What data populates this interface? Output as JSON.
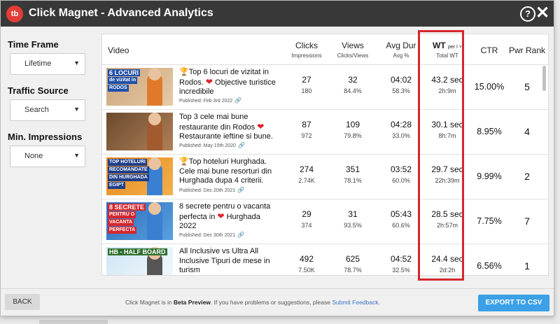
{
  "window": {
    "title": "Click Magnet - Advanced Analytics",
    "logo_text": "tb",
    "help_icon": "question-circle-icon",
    "close_icon": "close-icon"
  },
  "filters": {
    "time_frame": {
      "label": "Time Frame",
      "value": "Lifetime"
    },
    "traffic_source": {
      "label": "Traffic Source",
      "value": "Search"
    },
    "min_impressions": {
      "label": "Min. Impressions",
      "value": "None"
    }
  },
  "columns": {
    "video": "Video",
    "clicks": {
      "main": "Clicks",
      "sub": "Impressions"
    },
    "views": {
      "main": "Views",
      "sub": "Clicks/Views"
    },
    "avg_dur": {
      "main": "Avg Dur",
      "sub": "Avg %"
    },
    "wt": {
      "main": "WT",
      "per": "per I",
      "sub": "Total WT"
    },
    "ctr": "CTR",
    "pwr_rank": "Pwr Rank"
  },
  "rows": [
    {
      "title_pre": "Top 6 locuri de vizitat in Rodos.",
      "title_post": "Objective turistice incredibile",
      "trophy": true,
      "heart": true,
      "published": "Published: Feb 3rd 2022",
      "clicks": "27",
      "impressions": "180",
      "views": "32",
      "clicks_views": "84.4%",
      "avg_dur": "04:02",
      "avg_pct": "58.3%",
      "wt": "43.2 sec",
      "total_wt": "2h:9m",
      "ctr": "15.00%",
      "pwr_rank": "5",
      "thumb_text_1": "6 LOCURI",
      "thumb_text_2": "de vizitat in",
      "thumb_text_3": "RODOS"
    },
    {
      "title_pre": "Top 3 cele mai bune restaurante din Rodos",
      "title_post": "Restaurante ieftine si bune.",
      "trophy": false,
      "heart": true,
      "published": "Published: May 15th 2020",
      "clicks": "87",
      "impressions": "972",
      "views": "109",
      "clicks_views": "79.8%",
      "avg_dur": "04:28",
      "avg_pct": "33.0%",
      "wt": "30.1 sec",
      "total_wt": "8h:7m",
      "ctr": "8.95%",
      "pwr_rank": "4"
    },
    {
      "title_pre": "Top hoteluri Hurghada. Cele mai bune resorturi din Hurghada dupa 4 criterii.",
      "title_post": "",
      "trophy": true,
      "heart": false,
      "published": "Published: Dec 20th 2021",
      "clicks": "274",
      "impressions": "2.74K",
      "views": "351",
      "clicks_views": "78.1%",
      "avg_dur": "03:52",
      "avg_pct": "60.0%",
      "wt": "29.7 sec",
      "total_wt": "22h:39m",
      "ctr": "9.99%",
      "pwr_rank": "2",
      "thumb_text_1": "TOP HOTELURI",
      "thumb_text_2": "RECOMANDATE",
      "thumb_text_3": "DIN HURGHADA",
      "thumb_text_4": "EGIPT"
    },
    {
      "title_pre": "8 secrete pentru o vacanta perfecta in",
      "title_post": "Hurghada 2022",
      "trophy": false,
      "heart": true,
      "published": "Published: Dec 30th 2021",
      "clicks": "29",
      "impressions": "374",
      "views": "31",
      "clicks_views": "93.5%",
      "avg_dur": "05:43",
      "avg_pct": "60.6%",
      "wt": "28.5 sec",
      "total_wt": "2h:57m",
      "ctr": "7.75%",
      "pwr_rank": "7",
      "thumb_text_1": "8 SECRETE",
      "thumb_text_2": "PENTRU O",
      "thumb_text_3": "VACANTA",
      "thumb_text_4": "PERFECTA"
    },
    {
      "title_pre": "All Inclusive vs Ultra All Inclusive Tipuri de mese in turism",
      "title_post": "",
      "trophy": false,
      "heart": false,
      "published": "",
      "clicks": "492",
      "impressions": "7.50K",
      "views": "625",
      "clicks_views": "78.7%",
      "avg_dur": "04:52",
      "avg_pct": "32.5%",
      "wt": "24.4 sec",
      "total_wt": "2d:2h",
      "ctr": "6.56%",
      "pwr_rank": "1",
      "thumb_text_1": "HB - HALF BOARD"
    }
  ],
  "footer": {
    "back": "BACK",
    "msg_pre": "Click Magnet is in",
    "msg_bold": "Beta Preview",
    "msg_mid": ". If you have problems or suggestions, please",
    "msg_link": "Submit Feedback",
    "msg_end": ".",
    "export": "EXPORT TO CSV"
  },
  "colors": {
    "titlebar": "#383838",
    "accent_red": "#d6262d",
    "export_blue": "#3ba0e6",
    "logo_red": "#e43c36"
  }
}
